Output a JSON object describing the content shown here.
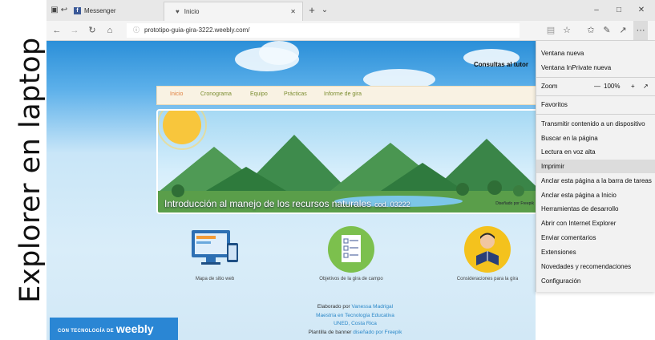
{
  "caption": "Explorer en laptop",
  "browser": {
    "tabs": [
      {
        "title": "Messenger"
      },
      {
        "title": "Inicio"
      }
    ],
    "address": "prototipo-guia-gira-3222.weebly.com/"
  },
  "page": {
    "tutor_link": "Consultas al tutor",
    "nav": [
      "Inicio",
      "Cronograma",
      "Equipo",
      "Prácticas",
      "Informe de gira"
    ],
    "banner": {
      "title": "Introducción al manejo de los recursos naturales",
      "code": "cod. 03222",
      "credit": "Diseñado por Freepik"
    },
    "features": [
      {
        "caption": "Mapa de sitio web",
        "icon": "website-devices-icon"
      },
      {
        "caption": "Objetivos de la gira de campo",
        "icon": "checklist-icon"
      },
      {
        "caption": "Consideraciones para la gira",
        "icon": "student-reading-icon"
      }
    ],
    "footer": {
      "elaborado": "Elaborado por",
      "author": "Vanessa Madrigal",
      "program": "Maestría en Tecnología Educativa",
      "institution": "UNED, Costa Rica",
      "plantilla": "Plantilla de banner",
      "credit": "diseñado por Freepik"
    },
    "weebly": {
      "prefix": "CON TECNOLOGÍA DE",
      "brand": "weebly"
    }
  },
  "menu": {
    "items": [
      "Ventana nueva",
      "Ventana InPrivate nueva",
      "Favoritos",
      "Transmitir contenido a un dispositivo",
      "Buscar en la página",
      "Lectura en voz alta",
      "Imprimir",
      "Anclar esta página a la barra de tareas",
      "Anclar esta página a Inicio",
      "Herramientas de desarrollo",
      "Abrir con Internet Explorer",
      "Enviar comentarios",
      "Extensiones",
      "Novedades y recomendaciones",
      "Configuración"
    ],
    "zoom": {
      "label": "Zoom",
      "value": "100%"
    }
  },
  "colors": {
    "accent": "#2a86d4",
    "nav_text": "#7b8d30",
    "nav_active": "#e08040",
    "facebook": "#3b5998"
  }
}
